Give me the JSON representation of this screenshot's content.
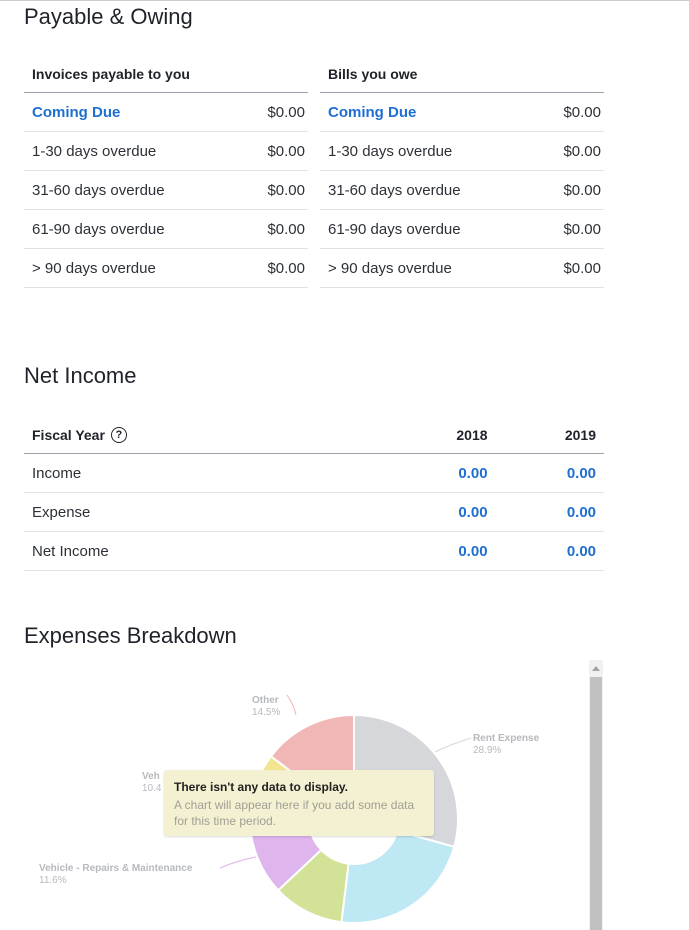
{
  "sections": {
    "payable_title": "Payable & Owing",
    "net_income_title": "Net Income",
    "expenses_title": "Expenses Breakdown"
  },
  "payable": {
    "header": "Invoices payable to you",
    "rows": [
      {
        "label": "Coming Due",
        "amount": "$0.00"
      },
      {
        "label": "1-30 days overdue",
        "amount": "$0.00"
      },
      {
        "label": "31-60 days overdue",
        "amount": "$0.00"
      },
      {
        "label": "61-90 days overdue",
        "amount": "$0.00"
      },
      {
        "label": "> 90 days overdue",
        "amount": "$0.00"
      }
    ]
  },
  "owing": {
    "header": "Bills you owe",
    "rows": [
      {
        "label": "Coming Due",
        "amount": "$0.00"
      },
      {
        "label": "1-30 days overdue",
        "amount": "$0.00"
      },
      {
        "label": "31-60 days overdue",
        "amount": "$0.00"
      },
      {
        "label": "61-90 days overdue",
        "amount": "$0.00"
      },
      {
        "label": "> 90 days overdue",
        "amount": "$0.00"
      }
    ]
  },
  "net_income": {
    "header_label": "Fiscal Year",
    "help_icon": "question-circle-icon",
    "years": [
      "2018",
      "2019"
    ],
    "rows": [
      {
        "label": "Income",
        "values": [
          "0.00",
          "0.00"
        ]
      },
      {
        "label": "Expense",
        "values": [
          "0.00",
          "0.00"
        ]
      },
      {
        "label": "Net Income",
        "values": [
          "0.00",
          "0.00"
        ]
      }
    ]
  },
  "chart_data": {
    "type": "pie",
    "style": "donut",
    "slices": [
      {
        "name": "Rent Expense",
        "percent": 28.9,
        "color": "#d5d7da"
      },
      {
        "name": "Repairs & Maintenance",
        "percent": 22.3,
        "color": "#bde8f4"
      },
      {
        "name": "",
        "percent": 10.9,
        "color": "#d2e397"
      },
      {
        "name": "Vehicle - Repairs & Maintenance",
        "percent": 11.6,
        "color": "#dfb5ed"
      },
      {
        "name": "Vehicle",
        "percent": 10.4,
        "color": "#f3e590"
      },
      {
        "name": "Other",
        "percent": 14.5,
        "color": "#f1b6b6"
      }
    ],
    "shown_labels": [
      {
        "name": "Other",
        "pct": "14.5%"
      },
      {
        "name": "Rent Expense",
        "pct": "28.9%"
      },
      {
        "name": "Veh",
        "pct": "10.4"
      },
      {
        "name": "Vehicle - Repairs & Maintenance",
        "pct": "11.6%"
      }
    ],
    "tooltip": {
      "title": "There isn't any data to display.",
      "body": "A chart will appear here if you add some data for this time period."
    }
  }
}
